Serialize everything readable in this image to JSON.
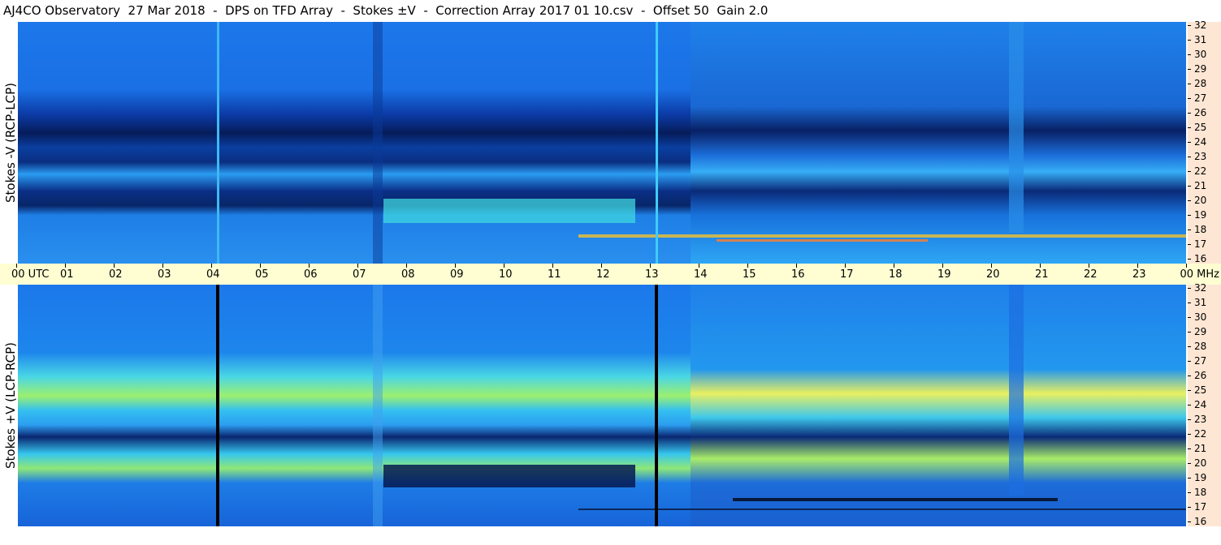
{
  "title": "AJ4CO Observatory  27 Mar 2018  -  DPS on TFD Array  -  Stokes ±V  -  Correction Array 2017 01 10.csv  -  Offset 50  Gain 2.0",
  "panels": {
    "top": {
      "label": "Stokes -V (RCP-LCP)"
    },
    "bottom": {
      "label": "Stokes +V (LCP-RCP)"
    }
  },
  "time_axis": {
    "labels": [
      "00  UTC",
      "01",
      "02",
      "03",
      "04",
      "05",
      "06",
      "07",
      "08",
      "09",
      "10",
      "11",
      "12",
      "13",
      "14",
      "15",
      "16",
      "17",
      "18",
      "19",
      "20",
      "21",
      "22",
      "23",
      "00  MHz"
    ]
  },
  "freq_axis": {
    "labels": [
      "32",
      "31",
      "30",
      "29",
      "28",
      "27",
      "26",
      "25",
      "24",
      "23",
      "22",
      "21",
      "20",
      "19",
      "18",
      "17",
      "16"
    ]
  },
  "colors": {
    "utc_strip": "#fefed2",
    "freq_strip": "#fde6d3",
    "background_blue": "#1a6ee6"
  }
}
